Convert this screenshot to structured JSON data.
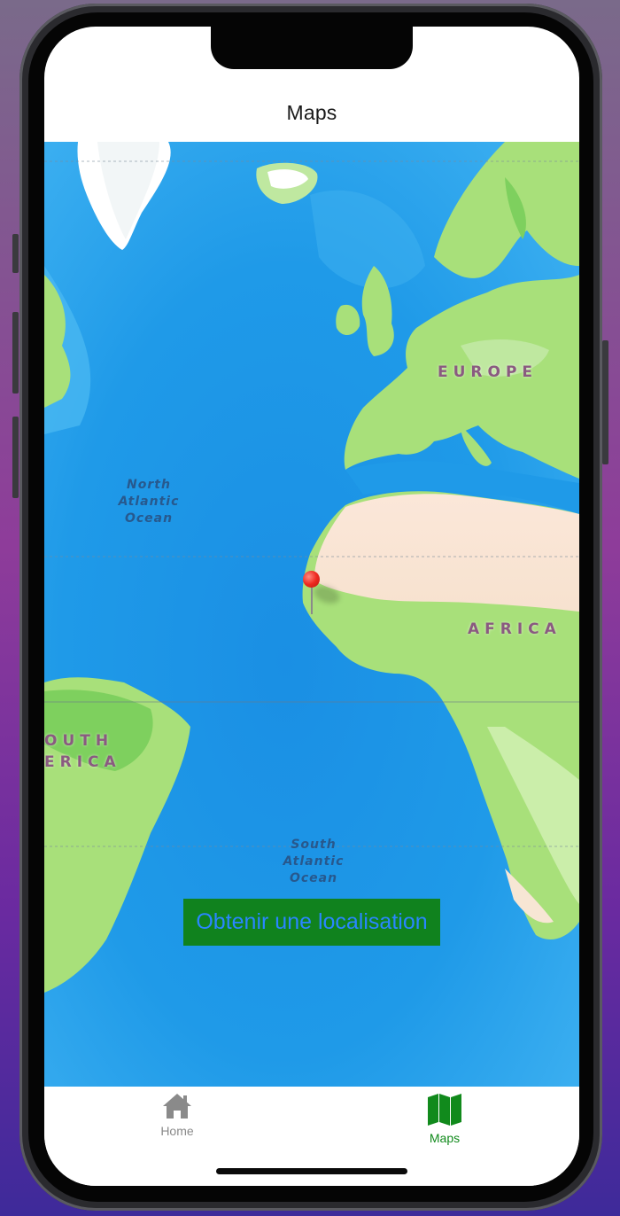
{
  "nav": {
    "title": "Maps"
  },
  "map": {
    "labels": {
      "europe": "EUROPE",
      "africa": "AFRICA",
      "south_america_line1": "OUTH",
      "south_america_line2": "ERICA",
      "north_atlantic": [
        "North",
        "Atlantic",
        "Ocean"
      ],
      "south_atlantic": [
        "South",
        "Atlantic",
        "Ocean"
      ]
    },
    "colors": {
      "ocean": "#1f9ae8",
      "deep_ocean": "#168fe0",
      "land": "#a8e07a",
      "desert": "#fbe6d8",
      "ice": "#ffffff"
    }
  },
  "action_button": {
    "label": "Obtenir une localisation",
    "bg": "#10821e",
    "text": "#2a86ff"
  },
  "tabs": [
    {
      "label": "Home",
      "icon": "home-icon",
      "active": false
    },
    {
      "label": "Maps",
      "icon": "map-icon",
      "active": true
    }
  ],
  "accent": "#118a1c"
}
